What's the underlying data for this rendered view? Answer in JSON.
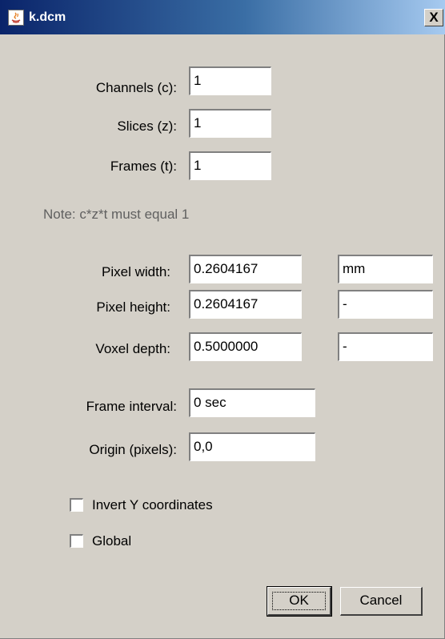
{
  "window": {
    "title": "k.dcm",
    "close_label": "X",
    "icon": "java-icon"
  },
  "form": {
    "channels": {
      "label": "Channels (c):",
      "value": "1"
    },
    "slices": {
      "label": "Slices (z):",
      "value": "1"
    },
    "frames": {
      "label": "Frames (t):",
      "value": "1"
    },
    "note": "Note: c*z*t must equal 1",
    "pixel_width": {
      "label": "Pixel width:",
      "value": "0.2604167",
      "unit": "mm"
    },
    "pixel_height": {
      "label": "Pixel height:",
      "value": "0.2604167",
      "unit": "-"
    },
    "voxel_depth": {
      "label": "Voxel depth:",
      "value": "0.5000000",
      "unit": "-"
    },
    "frame_interval": {
      "label": "Frame interval:",
      "value": "0 sec"
    },
    "origin": {
      "label": "Origin (pixels):",
      "value": "0,0"
    },
    "invert_y": {
      "label": "Invert Y coordinates",
      "checked": false
    },
    "global": {
      "label": "Global",
      "checked": false
    }
  },
  "buttons": {
    "ok": "OK",
    "cancel": "Cancel"
  },
  "colors": {
    "dialog_bg": "#d4d0c8",
    "titlebar_start": "#0a246a",
    "titlebar_end": "#a6caf0"
  }
}
